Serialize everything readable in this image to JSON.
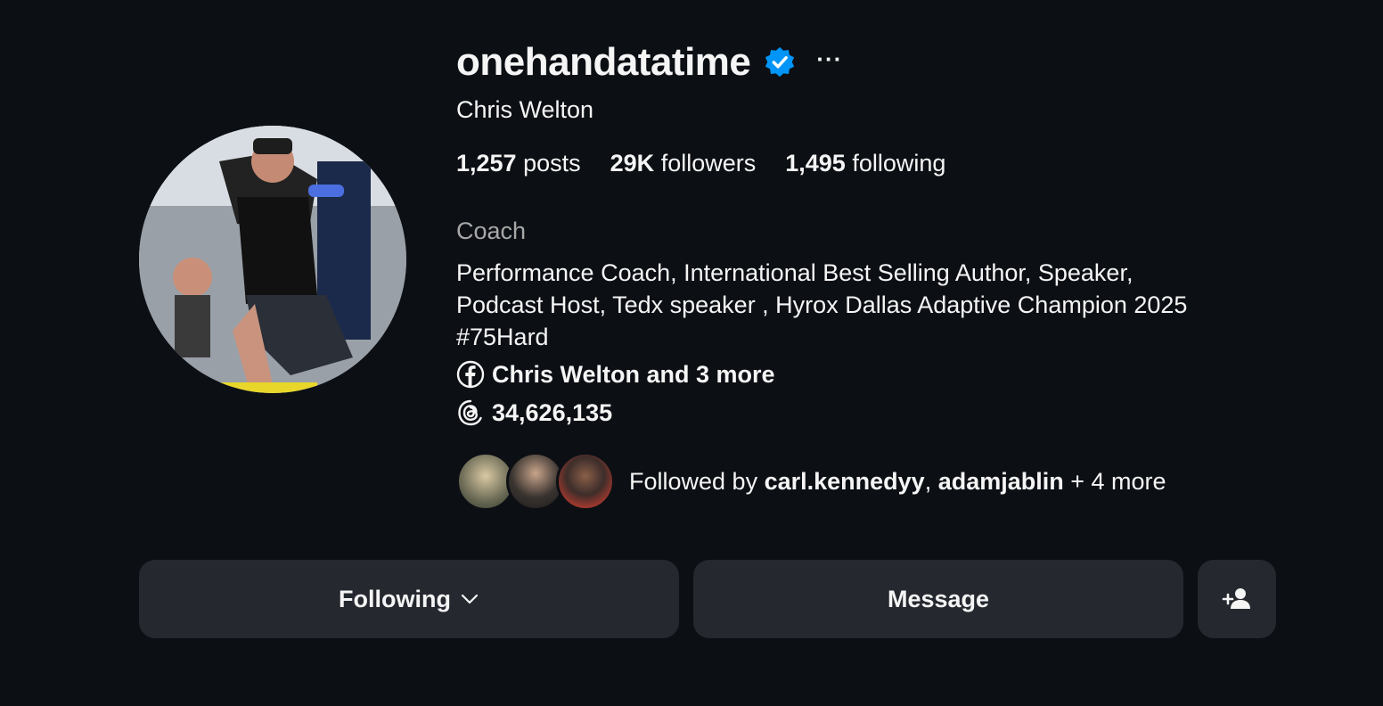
{
  "profile": {
    "username": "onehandatatime",
    "full_name": "Chris Welton",
    "verified": true,
    "more_icon": "ellipsis-icon",
    "stats": [
      {
        "count": "1,257",
        "label": "posts"
      },
      {
        "count": "29K",
        "label": "followers"
      },
      {
        "count": "1,495",
        "label": "following"
      }
    ],
    "category": "Coach",
    "bio_lines": [
      "Performance Coach, International Best Selling Author, Speaker,",
      "Podcast Host, Tedx speaker , Hyrox Dallas Adaptive Champion 2025",
      "#75Hard"
    ],
    "facebook_link": "Chris Welton and 3 more",
    "threads_link": "34,626,135",
    "followed_by": {
      "prefix": "Followed by ",
      "user1": "carl.kennedyy",
      "separator": ", ",
      "user2": "adamjablin",
      "suffix": " + 4 more"
    }
  },
  "actions": {
    "following_label": "Following",
    "message_label": "Message",
    "add_icon": "add-person-icon"
  },
  "colors": {
    "background": "#0c0f14",
    "button_bg": "#25292f",
    "verified_blue": "#0095f6",
    "secondary_text": "#a8a8a8"
  }
}
